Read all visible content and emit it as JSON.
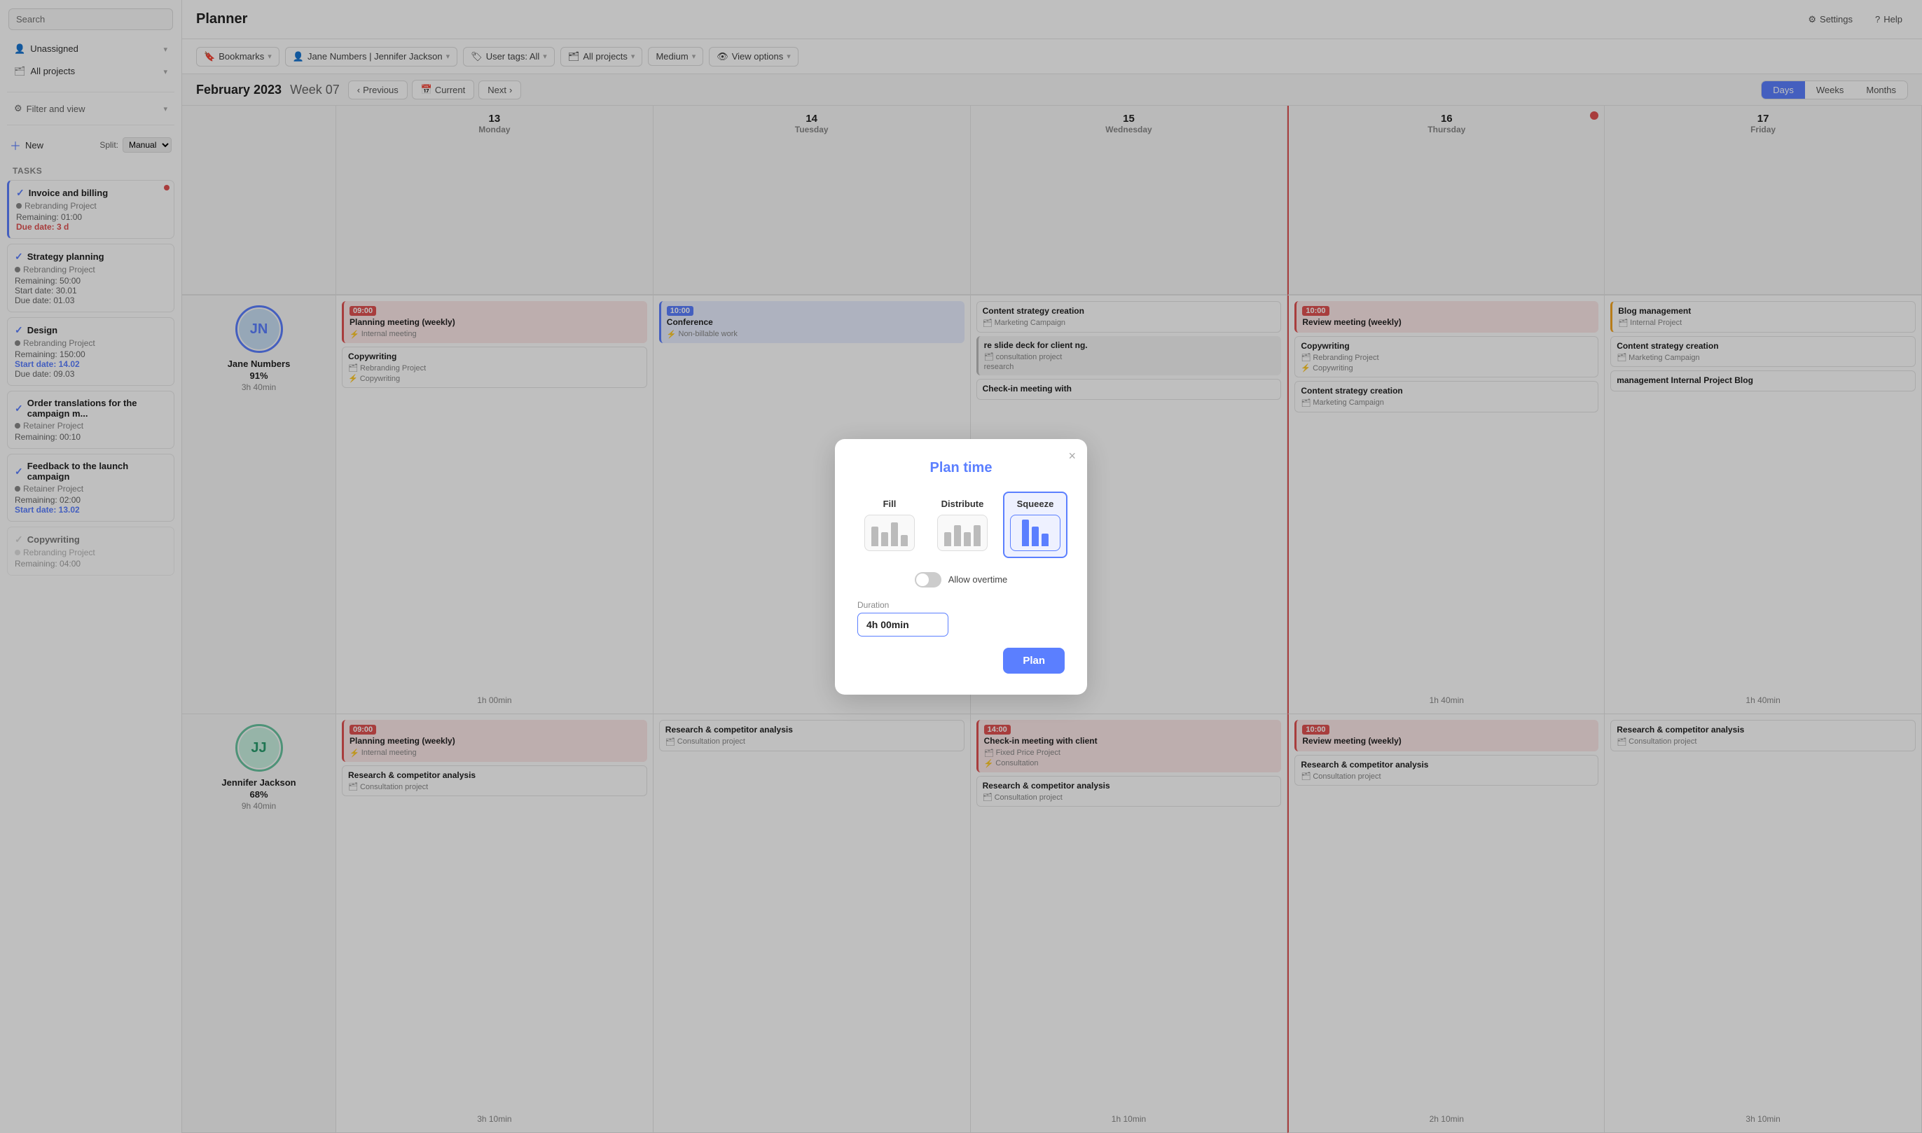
{
  "sidebar": {
    "search_placeholder": "Search",
    "unassigned_label": "Unassigned",
    "all_projects_label": "All projects",
    "filter_label": "Filter and view",
    "new_label": "New",
    "split_label": "Split:",
    "split_value": "Manual",
    "tasks_header": "Tasks",
    "tasks": [
      {
        "id": "t1",
        "title": "Invoice and billing",
        "project": "Rebranding Project",
        "remaining": "Remaining: 01:00",
        "due": "Due date: 3 d",
        "due_class": "date-red",
        "checked": true,
        "has_alert": true
      },
      {
        "id": "t2",
        "title": "Strategy planning",
        "project": "Rebranding Project",
        "remaining": "Remaining: 50:00",
        "start": "Start date: 30.01",
        "due": "Due date: 01.03",
        "due_class": "",
        "checked": true,
        "has_alert": false
      },
      {
        "id": "t3",
        "title": "Design",
        "project": "Rebranding Project",
        "remaining": "Remaining: 150:00",
        "start": "Start date: 14.02",
        "due": "Due date: 09.03",
        "due_class": "date-blue",
        "checked": true,
        "has_alert": false
      },
      {
        "id": "t4",
        "title": "Order translations for the campaign m...",
        "project": "Retainer Project",
        "remaining": "Remaining: 00:10",
        "due": "",
        "due_class": "",
        "checked": true,
        "has_alert": false
      },
      {
        "id": "t5",
        "title": "Feedback to the launch campaign",
        "project": "Retainer Project",
        "remaining": "Remaining: 02:00",
        "start": "Start date: 13.02",
        "due": "",
        "due_class": "date-blue",
        "checked": true,
        "has_alert": false
      },
      {
        "id": "t6",
        "title": "Copywriting",
        "project": "Rebranding Project",
        "remaining": "Remaining: 04:00",
        "due": "",
        "due_class": "",
        "checked": false,
        "has_alert": false
      }
    ]
  },
  "header": {
    "title": "Planner",
    "settings_label": "Settings",
    "help_label": "Help"
  },
  "toolbar": {
    "bookmarks_label": "Bookmarks",
    "users_label": "Jane Numbers | Jennifer Jackson",
    "user_tags_label": "User tags: All",
    "projects_label": "All projects",
    "medium_label": "Medium",
    "view_options_label": "View options"
  },
  "nav": {
    "title": "February 2023",
    "week": "Week 07",
    "previous_label": "Previous",
    "current_label": "Current",
    "next_label": "Next",
    "views": [
      "Days",
      "Weeks",
      "Months"
    ],
    "active_view": "Days"
  },
  "calendar": {
    "columns": [
      {
        "day_num": "13",
        "day_name": "Monday"
      },
      {
        "day_num": "14",
        "day_name": "Tuesday"
      },
      {
        "day_num": "15",
        "day_name": "Wednesday"
      },
      {
        "day_num": "16",
        "day_name": "Thursday"
      },
      {
        "day_num": "17",
        "day_name": "Friday"
      }
    ],
    "users": [
      {
        "name": "Jane Numbers",
        "percent": "91%",
        "time": "3h 40min",
        "initials": "JN",
        "days": [
          {
            "events": [
              {
                "time": "09:00",
                "time_color": "red",
                "title": "Planning meeting (weekly)",
                "sub": "Internal meeting",
                "sub_icon": "⚡",
                "color": "red"
              },
              {
                "time": "",
                "time_color": "",
                "title": "Copywriting",
                "sub": "Rebranding Project",
                "sub_icon2": "⚡",
                "sub2": "Copywriting",
                "color": "white"
              }
            ],
            "bottom_time": "1h 00min"
          },
          {
            "events": [
              {
                "time": "10:00",
                "time_color": "blue",
                "title": "Conference",
                "sub": "Non-billable work",
                "color": "blue"
              }
            ],
            "bottom_time": ""
          },
          {
            "events": [
              {
                "time": "",
                "time_color": "",
                "title": "Content strategy creation",
                "sub": "Marketing Campaign",
                "color": "white"
              },
              {
                "time": "",
                "time_color": "",
                "title": "re slide deck for client ng.",
                "sub": "consultation project research",
                "color": "gray"
              },
              {
                "time": "",
                "time_color": "",
                "title": "Check-in meeting with",
                "sub": "",
                "color": "white"
              }
            ],
            "bottom_time": ""
          },
          {
            "events": [
              {
                "time": "10:00",
                "time_color": "red",
                "title": "Review meeting (weekly)",
                "sub": "",
                "color": "red"
              },
              {
                "time": "",
                "time_color": "",
                "title": "Copywriting",
                "sub": "Rebranding Project",
                "sub_icon": "⚡",
                "sub2": "Copywriting",
                "color": "white"
              },
              {
                "time": "",
                "time_color": "",
                "title": "Content strategy creation",
                "sub": "Marketing Campaign",
                "color": "white"
              }
            ],
            "bottom_time": "1h 40min",
            "is_today": true
          },
          {
            "events": [
              {
                "time": "",
                "time_color": "",
                "title": "Blog management",
                "sub": "Internal Project",
                "color": "white"
              },
              {
                "time": "",
                "time_color": "",
                "title": "Content strategy creation",
                "sub": "Marketing Campaign",
                "color": "white"
              },
              {
                "time": "",
                "time_color": "",
                "title": "management Internal Project Blog",
                "sub": "",
                "color": "white"
              }
            ],
            "bottom_time": "1h 40min"
          }
        ]
      },
      {
        "name": "Jennifer Jackson",
        "percent": "68%",
        "time": "9h 40min",
        "initials": "JJ",
        "days": [
          {
            "events": [
              {
                "time": "09:00",
                "time_color": "red",
                "title": "Planning meeting (weekly)",
                "sub": "Internal meeting",
                "color": "red"
              },
              {
                "time": "",
                "time_color": "",
                "title": "Research & competitor analysis",
                "sub": "Consultation project",
                "color": "white"
              }
            ],
            "bottom_time": "3h 10min"
          },
          {
            "events": [
              {
                "time": "",
                "time_color": "",
                "title": "Research & competitor analysis",
                "sub": "Consultation project",
                "color": "white"
              }
            ],
            "bottom_time": ""
          },
          {
            "events": [
              {
                "time": "14:00",
                "time_color": "red",
                "title": "Check-in meeting with client",
                "sub": "Fixed Price Project Consultation",
                "color": "red"
              },
              {
                "time": "",
                "time_color": "",
                "title": "Research & competitor analysis",
                "sub": "Consultation project",
                "color": "white"
              }
            ],
            "bottom_time": "1h 10min"
          },
          {
            "events": [
              {
                "time": "10:00",
                "time_color": "red",
                "title": "Review meeting (weekly)",
                "sub": "",
                "color": "red"
              },
              {
                "time": "",
                "time_color": "",
                "title": "Research & competitor analysis",
                "sub": "Consultation project",
                "color": "white"
              }
            ],
            "bottom_time": "2h 10min",
            "is_today": true
          },
          {
            "events": [
              {
                "time": "",
                "time_color": "",
                "title": "Research & competitor analysis",
                "sub": "Consultation project",
                "color": "white"
              }
            ],
            "bottom_time": "3h 10min"
          }
        ]
      }
    ]
  },
  "modal": {
    "title": "Plan time",
    "close_label": "×",
    "options": [
      {
        "id": "fill",
        "label": "Fill",
        "selected": false
      },
      {
        "id": "distribute",
        "label": "Distribute",
        "selected": false
      },
      {
        "id": "squeeze",
        "label": "Squeeze",
        "selected": true
      }
    ],
    "overtime_label": "Allow overtime",
    "overtime_on": false,
    "duration_label": "Duration",
    "duration_value": "4h 00min",
    "plan_button_label": "Plan"
  }
}
